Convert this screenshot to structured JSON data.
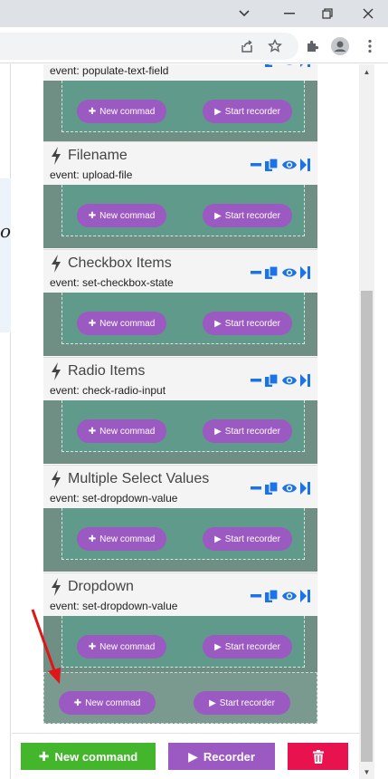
{
  "window": {
    "minimize_icon": "chevron-down-icon",
    "min_label": "—",
    "restore_label": "❐",
    "close_label": "✕"
  },
  "left_glyph": "on",
  "events": [
    {
      "title": "",
      "event": "event: populate-text-field"
    },
    {
      "title": "Filename",
      "event": "event: upload-file"
    },
    {
      "title": "Checkbox Items",
      "event": "event: set-checkbox-state"
    },
    {
      "title": "Radio Items",
      "event": "event: check-radio-input"
    },
    {
      "title": "Multiple Select Values",
      "event": "event: set-dropdown-value"
    },
    {
      "title": "Dropdown",
      "event": "event: set-dropdown-value"
    }
  ],
  "buttons": {
    "new_commad": "New commad",
    "start_recorder": "Start recorder"
  },
  "bottom": {
    "new_command": "New command",
    "recorder": "Recorder"
  },
  "colors": {
    "purple": "#9b59c2",
    "green": "#43b62c",
    "magenta": "#e8124e",
    "action_blue": "#1a73e8",
    "red_arrow": "#e01515"
  }
}
